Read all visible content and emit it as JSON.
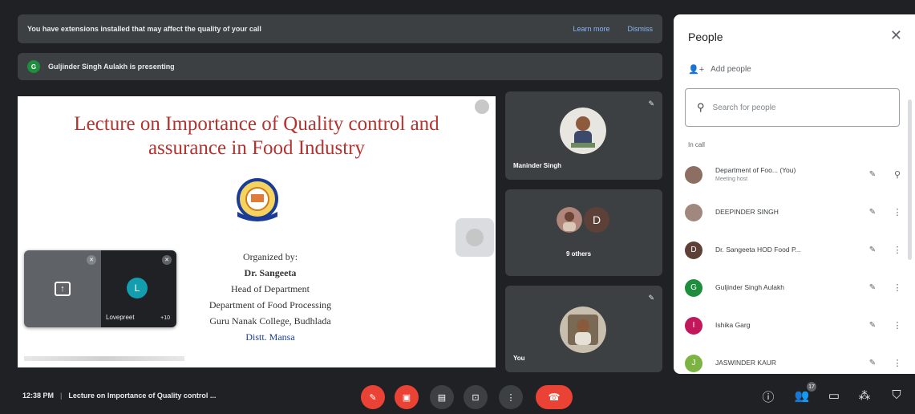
{
  "banner": {
    "message": "You have extensions installed that may affect the quality of your call",
    "learn_more": "Learn more",
    "dismiss": "Dismiss"
  },
  "presenting": {
    "avatar_letter": "G",
    "text": "Guljinder Singh Aulakh is presenting"
  },
  "slide": {
    "title_line1": "Lecture on Importance of Quality control and",
    "title_line2": "assurance in Food Industry",
    "organized_by": "Organized by:",
    "name": "Dr. Sangeeta",
    "designation": "Head of Department",
    "department": "Department of Food Processing",
    "college": "Guru Nanak College, Budhlada",
    "district": "Distt. Mansa"
  },
  "self_tiles": {
    "avatar_letter": "L",
    "name": "Lovepreet",
    "more": "+10"
  },
  "tiles": [
    {
      "name": "Maninder Singh"
    },
    {
      "name": "9 others",
      "avatar_letter": "D"
    },
    {
      "name": "You"
    }
  ],
  "panel": {
    "title": "People",
    "add_people": "Add people",
    "search_placeholder": "Search for people",
    "section": "In call",
    "people": [
      {
        "name": "Department of Foo... (You)",
        "sub": "Meeting host",
        "letter": "",
        "color": "#8d6e63"
      },
      {
        "name": "DEEPINDER SINGH",
        "sub": "",
        "letter": "",
        "color": "#a1887f"
      },
      {
        "name": "Dr. Sangeeta HOD Food P...",
        "sub": "",
        "letter": "D",
        "color": "#5d4037"
      },
      {
        "name": "Guljinder Singh Aulakh",
        "sub": "",
        "letter": "G",
        "color": "#1e8e3e"
      },
      {
        "name": "Ishika Garg",
        "sub": "",
        "letter": "I",
        "color": "#c2185b"
      },
      {
        "name": "JASWINDER KAUR",
        "sub": "",
        "letter": "J",
        "color": "#7cb342"
      }
    ]
  },
  "bottom": {
    "time": "12:38 PM",
    "meeting_title": "Lecture on Importance of Quality control ...",
    "participant_count": "17"
  },
  "colors": {
    "background": "#202124",
    "surface": "#3c4043",
    "accent_red": "#ea4335",
    "link": "#8ab4f8"
  }
}
